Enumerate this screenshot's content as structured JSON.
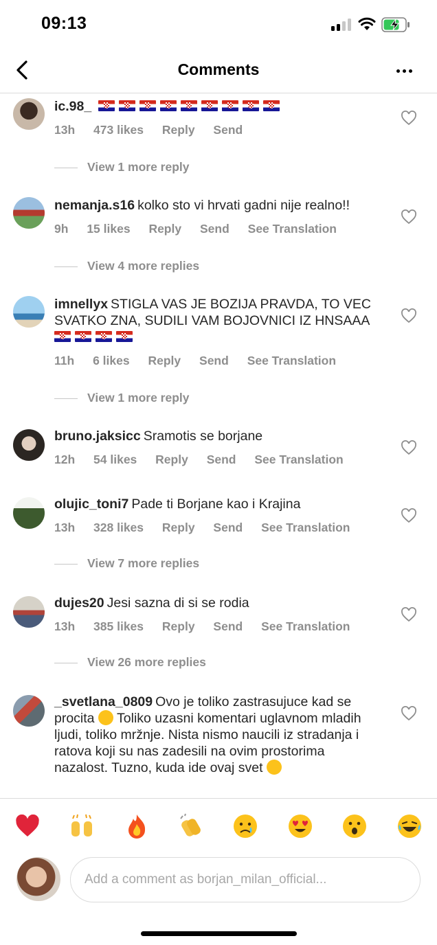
{
  "status": {
    "time": "09:13"
  },
  "header": {
    "title": "Comments"
  },
  "comments": [
    {
      "username": "ic.98_",
      "text": "",
      "flags": 9,
      "time": "13h",
      "likes": "473 likes",
      "reply": "Reply",
      "send": "Send",
      "translate": "",
      "view_replies": "View 1 more reply"
    },
    {
      "username": "nemanja.s16",
      "text": "kolko sto vi hrvati gadni nije realno!!",
      "time": "9h",
      "likes": "15 likes",
      "reply": "Reply",
      "send": "Send",
      "translate": "See Translation",
      "view_replies": "View 4 more replies"
    },
    {
      "username": "imnellyx",
      "text": "STIGLA VAS JE BOZIJA PRAVDA, TO VEC SVATKO ZNA, SUDILI VAM BOJOVNICI IZ HNSAAA",
      "flags": 4,
      "time": "11h",
      "likes": "6 likes",
      "reply": "Reply",
      "send": "Send",
      "translate": "See Translation",
      "view_replies": "View 1 more reply"
    },
    {
      "username": "bruno.jaksicc",
      "text": "Sramotis se borjane",
      "time": "12h",
      "likes": "54 likes",
      "reply": "Reply",
      "send": "Send",
      "translate": "See Translation",
      "view_replies": ""
    },
    {
      "username": "olujic_toni7",
      "text": "Pade ti Borjane kao i Krajina",
      "time": "13h",
      "likes": "328 likes",
      "reply": "Reply",
      "send": "Send",
      "translate": "See Translation",
      "view_replies": "View 7 more replies"
    },
    {
      "username": "dujes20",
      "text": "Jesi sazna di si se rodia",
      "time": "13h",
      "likes": "385 likes",
      "reply": "Reply",
      "send": "Send",
      "translate": "See Translation",
      "view_replies": "View 26 more replies"
    },
    {
      "username": "_svetlana_0809",
      "text_a": "Ovo je toliko zastrasujuce kad se procita",
      "text_b": "Toliko uzasni komentari uglavnom mladih ljudi, toliko mržnje. Nista nismo naucili iz stradanja i ratova koji su nas zadesili na ovim prostorima nazalost. Tuzno, kuda ide ovaj svet",
      "time": "",
      "likes": "",
      "reply": "",
      "send": "",
      "translate": "",
      "view_replies": ""
    }
  ],
  "reactions": [
    "heart",
    "raised-hands",
    "fire",
    "clapping-hands",
    "crying-face",
    "heart-eyes",
    "surprised-face",
    "laughing-face"
  ],
  "composer": {
    "placeholder": "Add a comment as borjan_milan_official..."
  },
  "colors": {
    "text": "#262626",
    "secondary": "#8e8e8e",
    "divider": "#dbdbdb"
  }
}
